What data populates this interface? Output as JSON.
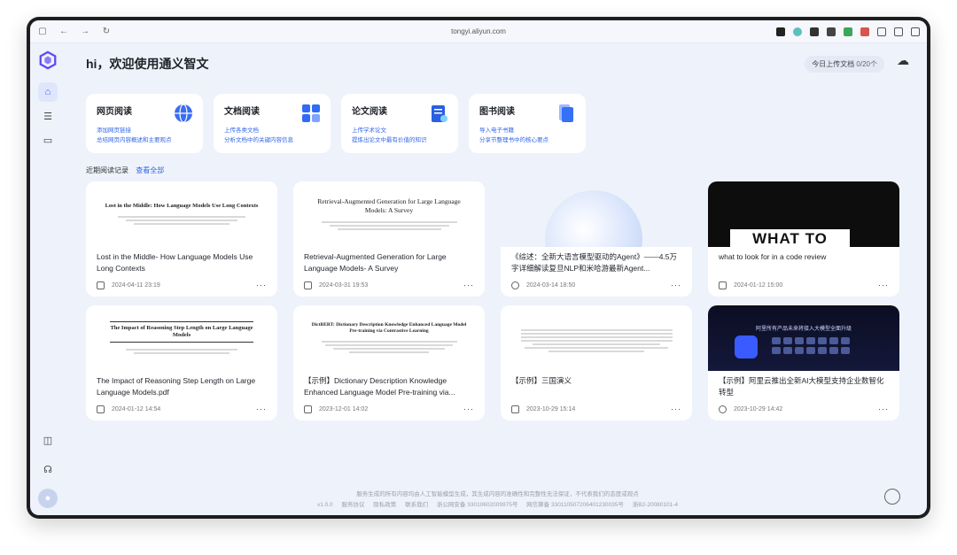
{
  "browser": {
    "url": "tongyi.aliyun.com"
  },
  "header": {
    "greeting": "hi，欢迎使用通义智文",
    "upload_label": "今日上传文档",
    "upload_count": "0/20个"
  },
  "quick_actions": [
    {
      "title": "网页阅读",
      "desc1": "添加网页链接",
      "desc2": "总结网页内容概述和主要观点",
      "color": "#3a6df0"
    },
    {
      "title": "文档阅读",
      "desc1": "上传各类文档",
      "desc2": "分析文档中的关键内容信息",
      "color": "#2f6bf5"
    },
    {
      "title": "论文阅读",
      "desc1": "上传学术论文",
      "desc2": "提炼出论文中最有价值的知识",
      "color": "#2a5fe0"
    },
    {
      "title": "图书阅读",
      "desc1": "导入电子书籍",
      "desc2": "分享节整理书中的核心要点",
      "color": "#3570f5"
    }
  ],
  "recent": {
    "label": "近期阅读记录",
    "view_all": "查看全部"
  },
  "documents": [
    {
      "thumb_title": "Lost in the Middle: How Language Models Use Long Contexts",
      "title": "Lost in the Middle- How Language Models Use Long Contexts",
      "date": "2024-04-11 23:19",
      "icon": "doc-icon"
    },
    {
      "thumb_title": "Retrieval-Augmented Generation for Large Language Models: A Survey",
      "title": "Retrieval-Augmented Generation for Large Language Models- A Survey",
      "date": "2024-03-31 19:53",
      "icon": "doc-icon"
    },
    {
      "thumb_title": "",
      "title": "《综述：全新大语言模型驱动的Agent》——4.5万字详细解读复旦NLP和米哈游最新Agent...",
      "date": "2024-03-14 18:50",
      "icon": "globe-icon"
    },
    {
      "thumb_title": "WHAT TO",
      "title": "what to look for in a code review",
      "date": "2024-01-12 15:00",
      "icon": "book-icon"
    },
    {
      "thumb_title": "The Impact of Reasoning Step Length on Large Language Models",
      "title": "The Impact of Reasoning Step Length on Large Language Models.pdf",
      "date": "2024-01-12 14:54",
      "icon": "doc-icon"
    },
    {
      "thumb_title": "DictBERT: Dictionary Description Knowledge Enhanced Language Model Pre-training via Contrastive Learning",
      "title": "【示例】Dictionary Description Knowledge Enhanced Language Model Pre-training via...",
      "date": "2023-12-01 14:02",
      "icon": "doc-icon"
    },
    {
      "thumb_title": "",
      "title": "【示例】三国演义",
      "date": "2023-10-29 15:14",
      "icon": "book-icon"
    },
    {
      "thumb_title": "阿里所有产品未来将接入大模型全面升级",
      "title": "【示例】阿里云推出全新AI大模型支持企业数智化转型",
      "date": "2023-10-29 14:42",
      "icon": "globe-icon"
    }
  ],
  "footer": {
    "notice": "服务生成的所有内容均由人工智能模型生成，其生成内容的准确性和完整性无法保证，不代表我们的态度或观点",
    "version": "v1.0.0",
    "links": [
      "服务协议",
      "隐私政策",
      "联系我们"
    ],
    "license1": "浙公网安备 33010602009975号",
    "license2": "网信算备 330110507206401230035号",
    "license3": "浙B2-20080101-4"
  }
}
